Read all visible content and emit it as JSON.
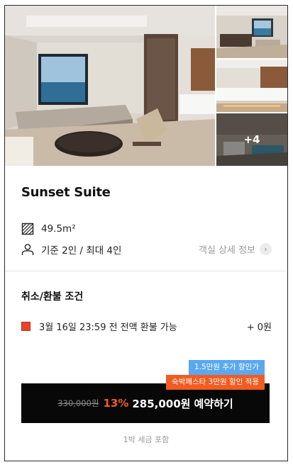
{
  "gallery": {
    "more_count": "+4"
  },
  "room": {
    "title": "Sunset Suite",
    "area": "49.5m²",
    "capacity": "기준 2인 / 최대 4인",
    "detail_link": "객실 상세 정보"
  },
  "refund": {
    "title": "취소/환불 조건",
    "condition": "3월 16일 23:59 전 전액 환불 가능",
    "amount": "+ 0원"
  },
  "promo": {
    "extra_discount": "1.5만원 추가 할인가",
    "festa_discount": "숙박페스타 3만원 할인 적용"
  },
  "booking": {
    "original_price": "330,000원",
    "discount_rate": "13%",
    "price": "285,000원",
    "label": "예약하기",
    "tax_note": "1박 세금 포함"
  },
  "colors": {
    "accent": "#f25c20",
    "badge_blue": "#5aa8f0",
    "refund_square": "#e8442a",
    "button_bg": "#080808"
  },
  "icons": [
    "area-icon",
    "person-icon",
    "chevron-right-icon"
  ]
}
